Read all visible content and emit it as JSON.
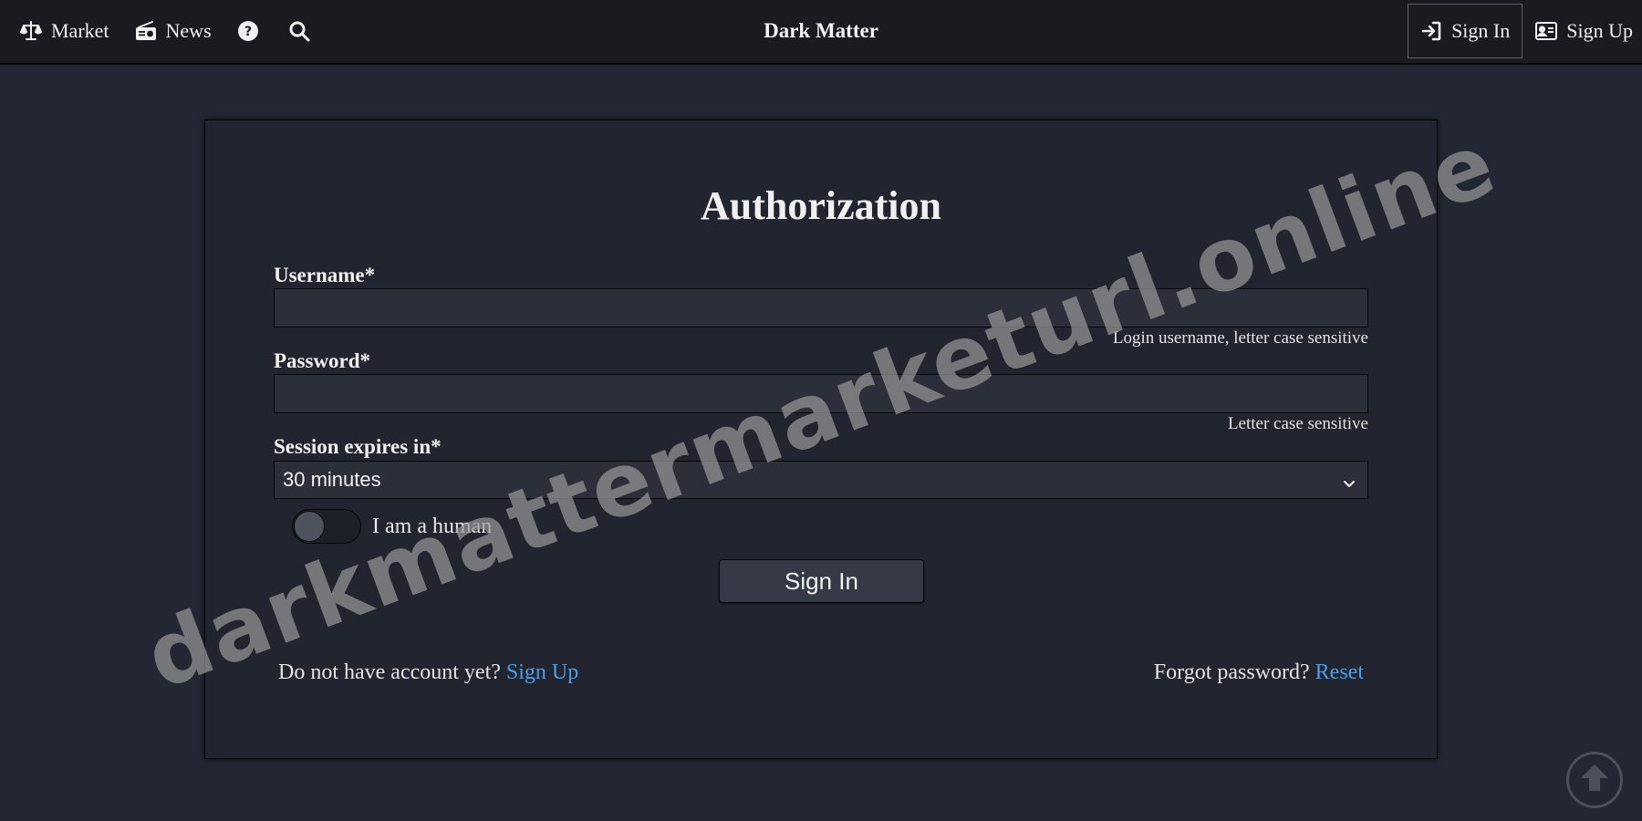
{
  "nav": {
    "market_label": "Market",
    "news_label": "News",
    "brand": "Dark Matter",
    "signin_label": "Sign In",
    "signup_label": "Sign Up"
  },
  "form": {
    "title": "Authorization",
    "username_label": "Username*",
    "username_value": "",
    "username_help": "Login username, letter case sensitive",
    "password_label": "Password*",
    "password_value": "",
    "password_help": "Letter case sensitive",
    "session_label": "Session expires in*",
    "session_selected": "30 minutes",
    "human_label": "I am a human",
    "human_checked": false,
    "submit_label": "Sign In"
  },
  "footer": {
    "no_account_text": "Do not have account yet? ",
    "signup_link": "Sign Up",
    "forgot_text": "Forgot password? ",
    "reset_link": "Reset"
  },
  "watermark": "darkmattermarketurl.online",
  "colors": {
    "background": "#232733",
    "topbar": "#191b21",
    "card": "#222530",
    "input": "#2c2f3a",
    "button": "#363a47",
    "link": "#4d9ee8"
  },
  "icons": [
    "scale-icon",
    "radio-icon",
    "help-circle-icon",
    "search-icon",
    "sign-in-icon",
    "id-card-icon",
    "chevron-down-icon",
    "arrow-up-circle-icon"
  ]
}
